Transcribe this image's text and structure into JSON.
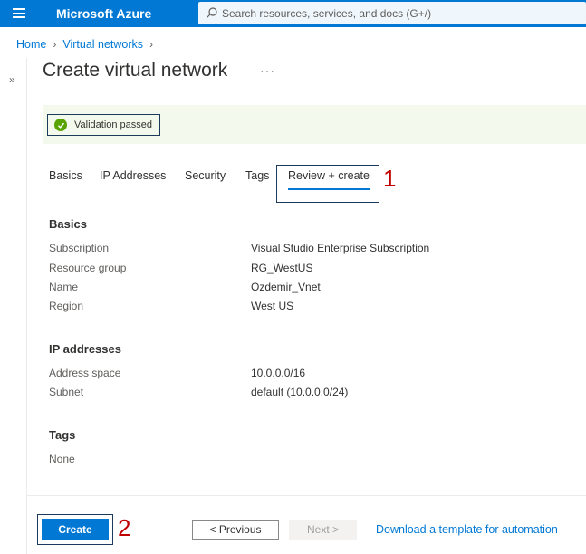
{
  "topbar": {
    "brand": "Microsoft Azure",
    "search_placeholder": "Search resources, services, and docs (G+/)"
  },
  "breadcrumb": [
    {
      "label": "Home"
    },
    {
      "label": "Virtual networks"
    }
  ],
  "page": {
    "title": "Create virtual network",
    "more": "···"
  },
  "validation": {
    "text": "Validation passed",
    "color": "#57a300"
  },
  "tabs": [
    {
      "label": "Basics"
    },
    {
      "label": "IP Addresses"
    },
    {
      "label": "Security"
    },
    {
      "label": "Tags"
    },
    {
      "label": "Review + create",
      "active": true
    }
  ],
  "markers": {
    "one": "1",
    "two": "2"
  },
  "sections": {
    "basics": {
      "heading": "Basics",
      "fields": [
        {
          "label": "Subscription",
          "value": "Visual Studio Enterprise Subscription"
        },
        {
          "label": "Resource group",
          "value": "RG_WestUS"
        },
        {
          "label": "Name",
          "value": "Ozdemir_Vnet"
        },
        {
          "label": "Region",
          "value": "West US"
        }
      ]
    },
    "ip": {
      "heading": "IP addresses",
      "fields": [
        {
          "label": "Address space",
          "value": "10.0.0.0/16"
        },
        {
          "label": "Subnet",
          "value": "default (10.0.0.0/24)"
        }
      ]
    },
    "tags": {
      "heading": "Tags",
      "none": "None"
    }
  },
  "footer": {
    "create": "Create",
    "previous": "< Previous",
    "next": "Next >",
    "download": "Download a template for automation"
  },
  "colors": {
    "accent": "#0078d4",
    "marker": "#c00000"
  }
}
